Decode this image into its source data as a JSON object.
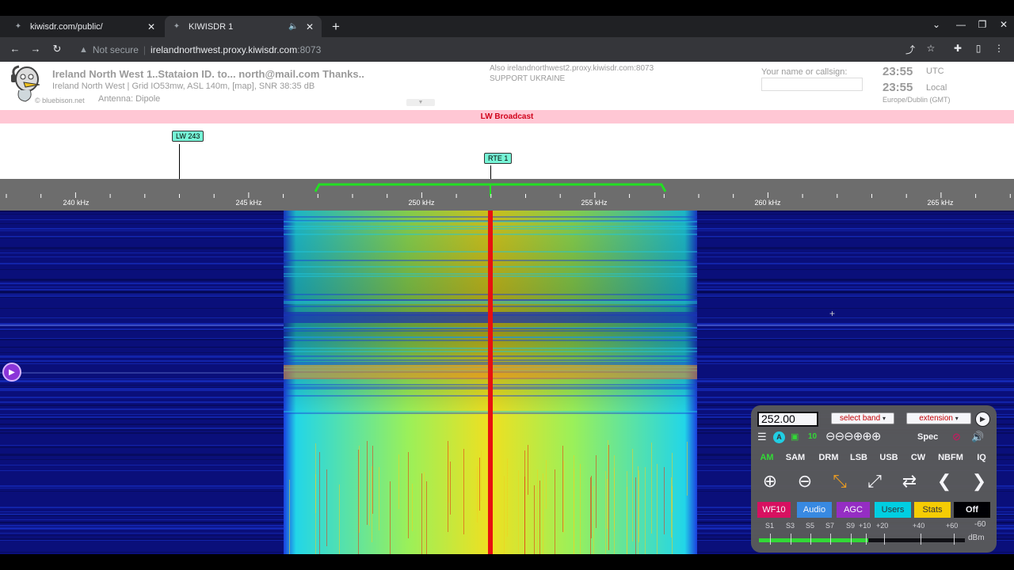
{
  "browser": {
    "tabs": [
      {
        "title": "kiwisdr.com/public/",
        "active": false
      },
      {
        "title": "KIWISDR 1",
        "active": true
      }
    ],
    "address": {
      "security": "Not secure",
      "host": "irelandnorthwest.proxy.kiwisdr.com",
      "port": ":8073"
    }
  },
  "header": {
    "title": "Ireland North West 1..Stataion ID. to... north@mail.com Thanks..",
    "location_line": "Ireland North West | Grid IO53mw, ASL 140m, [map], SNR 38:35 dB",
    "antenna": "Antenna: Dipole",
    "copyright": "© bluebison.net",
    "also_line": "Also irelandnorthwest2.proxy.kiwisdr.com:8073",
    "support_line": "SUPPORT UKRAINE",
    "callsign_label": "Your name or callsign:",
    "utc_time": "23:55",
    "utc_label": "UTC",
    "local_time": "23:55",
    "local_label": "Local",
    "timezone": "Europe/Dublin (GMT)"
  },
  "band_bar": {
    "label": "LW Broadcast"
  },
  "stations": [
    {
      "label": "LW 243"
    },
    {
      "label": "RTE 1"
    }
  ],
  "scale": {
    "tick_labels": [
      "240 kHz",
      "245 kHz",
      "250 kHz",
      "255 kHz",
      "260 kHz",
      "265 kHz"
    ]
  },
  "control_panel": {
    "frequency": "252.00",
    "band_select": "select band",
    "extension_select": "extension",
    "icons_row": {
      "a_label": "A",
      "ten_label": "10",
      "spec_label": "Spec"
    },
    "modes": [
      "AM",
      "SAM",
      "DRM",
      "LSB",
      "USB",
      "CW",
      "NBFM",
      "IQ"
    ],
    "active_mode": "AM",
    "panel_buttons": [
      {
        "label": "WF10",
        "color": "#e0115f"
      },
      {
        "label": "Audio",
        "color": "#3a8ee6"
      },
      {
        "label": "AGC",
        "color": "#9b2fc7"
      },
      {
        "label": "Users",
        "color": "#00d6e6"
      },
      {
        "label": "Stats",
        "color": "#ffd400"
      },
      {
        "label": "Off",
        "color": "#000000"
      }
    ],
    "smeter": {
      "labels": [
        "S1",
        "S3",
        "S5",
        "S7",
        "S9",
        "+10",
        "+20",
        "+40",
        "+60",
        "-60"
      ],
      "unit": "dBm",
      "level_fraction": 0.53
    }
  },
  "colors": {
    "band_bar_bg": "#ffc7d4",
    "band_bar_text": "#d0021b",
    "station_label_bg": "#76f5d6",
    "passband": "#22e022",
    "waterfall_bg": "#0a0f7a"
  }
}
